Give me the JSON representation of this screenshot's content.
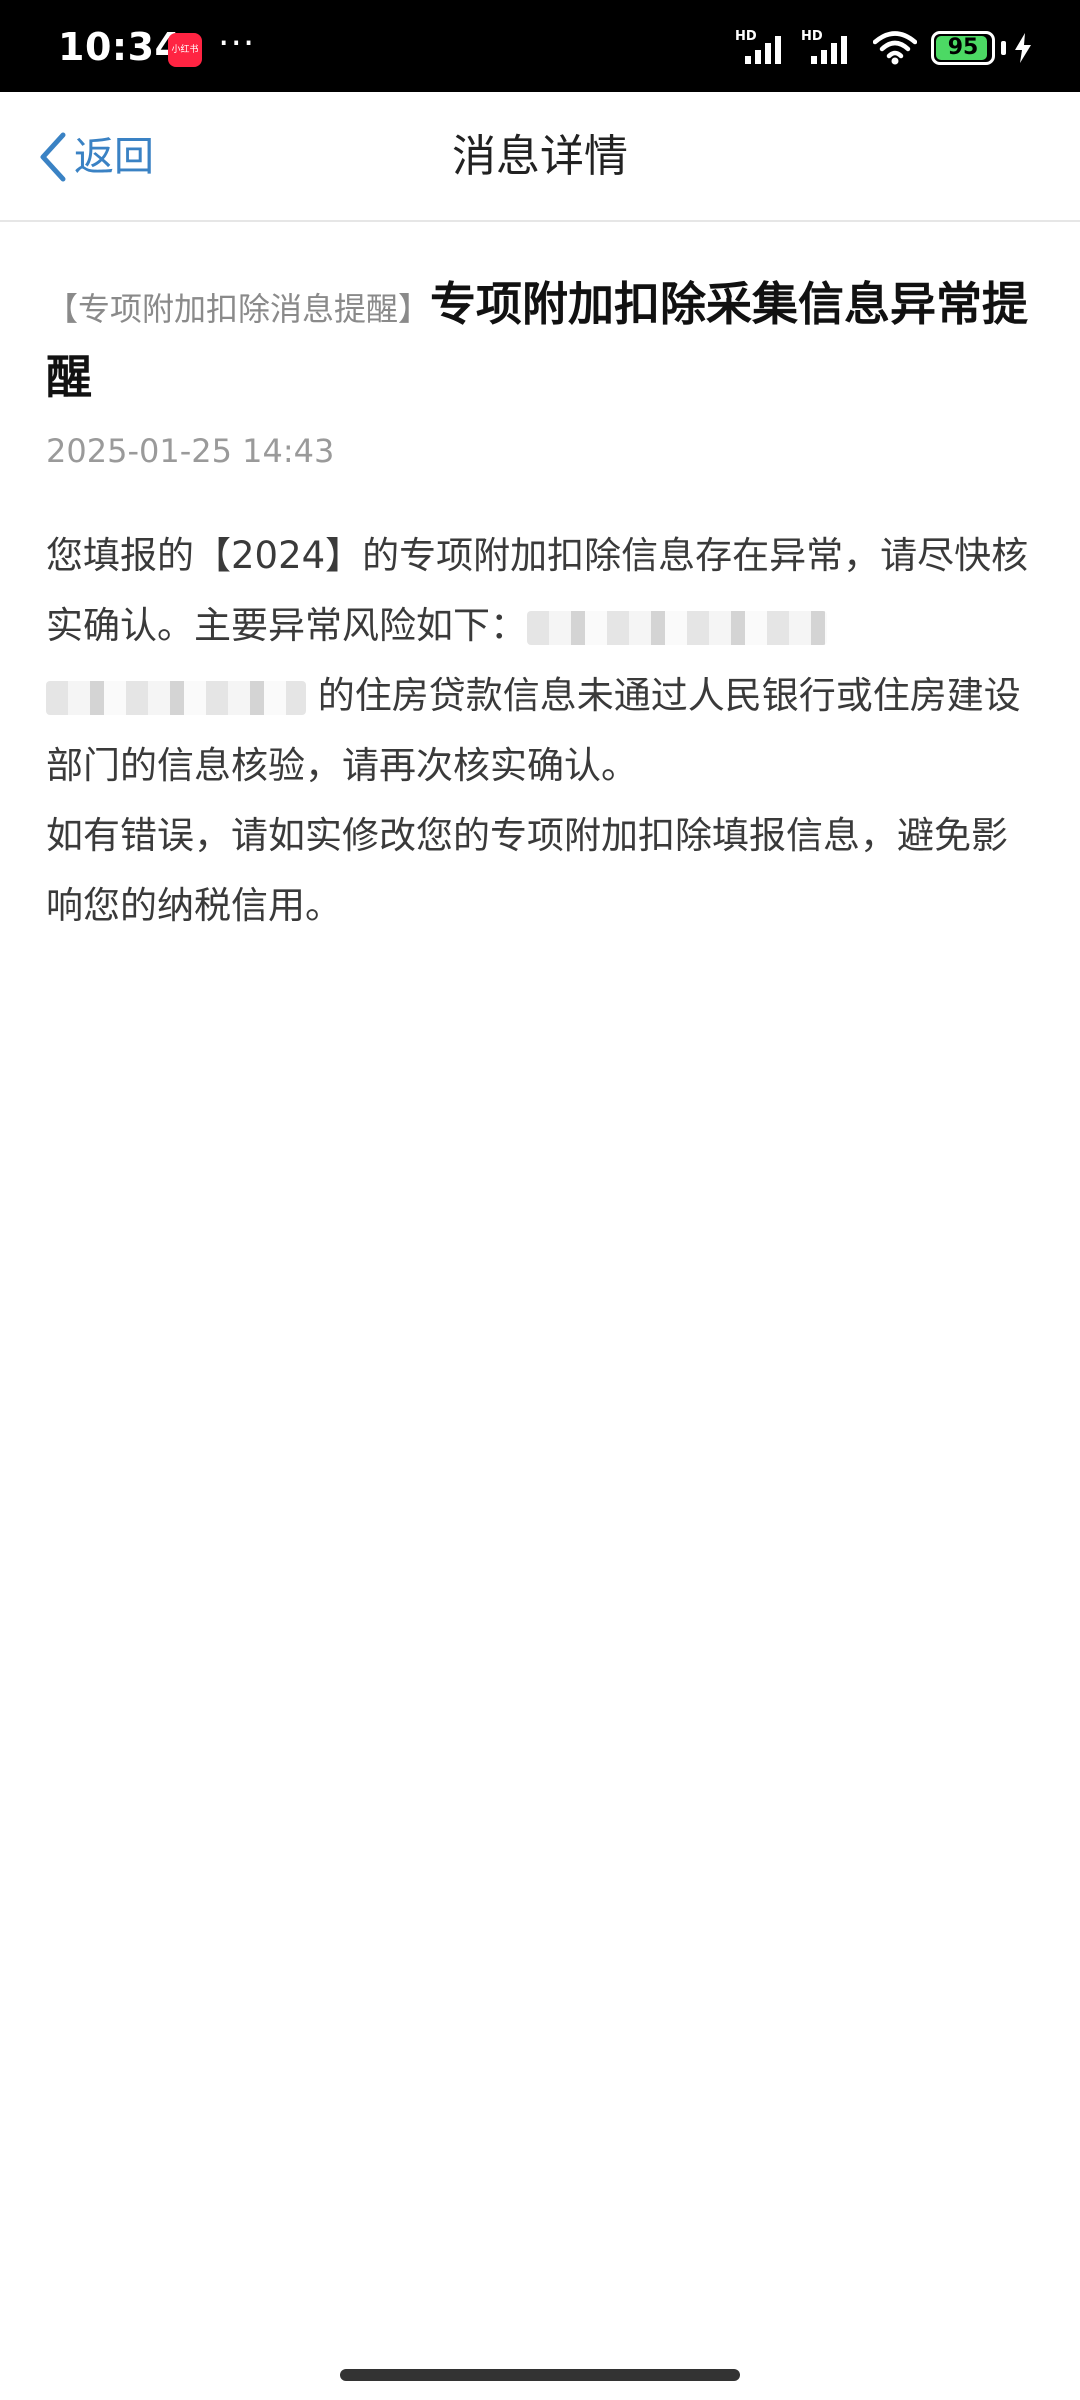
{
  "status_bar": {
    "time": "10:34",
    "app_badge": "小红书",
    "dots": "···",
    "hd_1": "HD",
    "hd_2": "HD",
    "battery_level": "95",
    "battery_fraction": 0.95
  },
  "nav": {
    "back_label": "返回",
    "title": "消息详情"
  },
  "message": {
    "tag": "【专项附加扣除消息提醒】",
    "title": "专项附加扣除采集信息异常提醒",
    "date": "2025-01-25 14:43",
    "body": {
      "p1_before_redaction": "您填报的【2024】的专项附加扣除信息存在异常，请尽快核实确认。主要异常风险如下：",
      "p1_after_redaction": "的住房贷款信息未通过人民银行或住房建设部门的信息核验，请再次核实确认。",
      "p2": "如有错误，请如实修改您的专项附加扣除填报信息，避免影响您的纳税信用。"
    }
  },
  "colors": {
    "accent": "#3a82c4",
    "status_bar_bg": "#000000",
    "battery_green": "#4cd964",
    "badge_red": "#ff2442"
  }
}
